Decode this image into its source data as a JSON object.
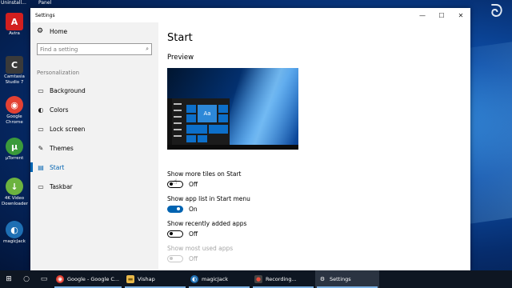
{
  "desktop": {
    "top_labels": [
      "Uninstall...",
      "Panel"
    ],
    "icons": [
      {
        "label": "Avira",
        "icon": "avira-icon",
        "color": "#d21f1f",
        "glyph": "A"
      },
      {
        "label": "Camtasia Studio 7",
        "icon": "camtasia-icon",
        "color": "#3a3a3a",
        "glyph": "C"
      },
      {
        "label": "Google Chrome",
        "icon": "chrome-icon",
        "color": "#e34133",
        "glyph": "◉"
      },
      {
        "label": "µTorrent",
        "icon": "utorrent-icon",
        "color": "#3b9a3b",
        "glyph": "µ"
      },
      {
        "label": "4K Video Downloader",
        "icon": "4k-video-downloader-icon",
        "color": "#6cb33f",
        "glyph": "↓"
      },
      {
        "label": "magicJack",
        "icon": "magicjack-icon",
        "color": "#1e6fb3",
        "glyph": "◐"
      }
    ]
  },
  "window": {
    "title": "Settings",
    "controls": {
      "minimize": "—",
      "maximize": "☐",
      "close": "✕"
    }
  },
  "sidebar": {
    "home": "Home",
    "search_placeholder": "Find a setting",
    "section": "Personalization",
    "items": [
      {
        "label": "Background",
        "glyph": "▭"
      },
      {
        "label": "Colors",
        "glyph": "◐"
      },
      {
        "label": "Lock screen",
        "glyph": "▭"
      },
      {
        "label": "Themes",
        "glyph": "✎"
      },
      {
        "label": "Start",
        "glyph": "▤"
      },
      {
        "label": "Taskbar",
        "glyph": "▭"
      }
    ]
  },
  "main": {
    "title": "Start",
    "preview_label": "Preview",
    "preview_tile": "Aa",
    "settings": [
      {
        "label": "Show more tiles on Start",
        "state": "Off",
        "on": false,
        "disabled": false
      },
      {
        "label": "Show app list in Start menu",
        "state": "On",
        "on": true,
        "disabled": false
      },
      {
        "label": "Show recently added apps",
        "state": "Off",
        "on": false,
        "disabled": false
      },
      {
        "label": "Show most used apps",
        "state": "Off",
        "on": false,
        "disabled": true
      }
    ]
  },
  "taskbar": {
    "apps": [
      {
        "label": "Google - Google C...",
        "icon": "chrome-icon",
        "color": "#e34133",
        "glyph": "◉"
      },
      {
        "label": "Vishap",
        "icon": "folder-icon",
        "color": "#e8b84a",
        "glyph": "▬"
      },
      {
        "label": "magicJack",
        "icon": "magicjack-icon",
        "color": "#1e6fb3",
        "glyph": "◐"
      },
      {
        "label": "Recording...",
        "icon": "camtasia-recorder-icon",
        "color": "#c0392b",
        "glyph": "●"
      },
      {
        "label": "Settings",
        "icon": "gear-icon",
        "color": "#ffffff",
        "glyph": "⚙"
      }
    ]
  }
}
